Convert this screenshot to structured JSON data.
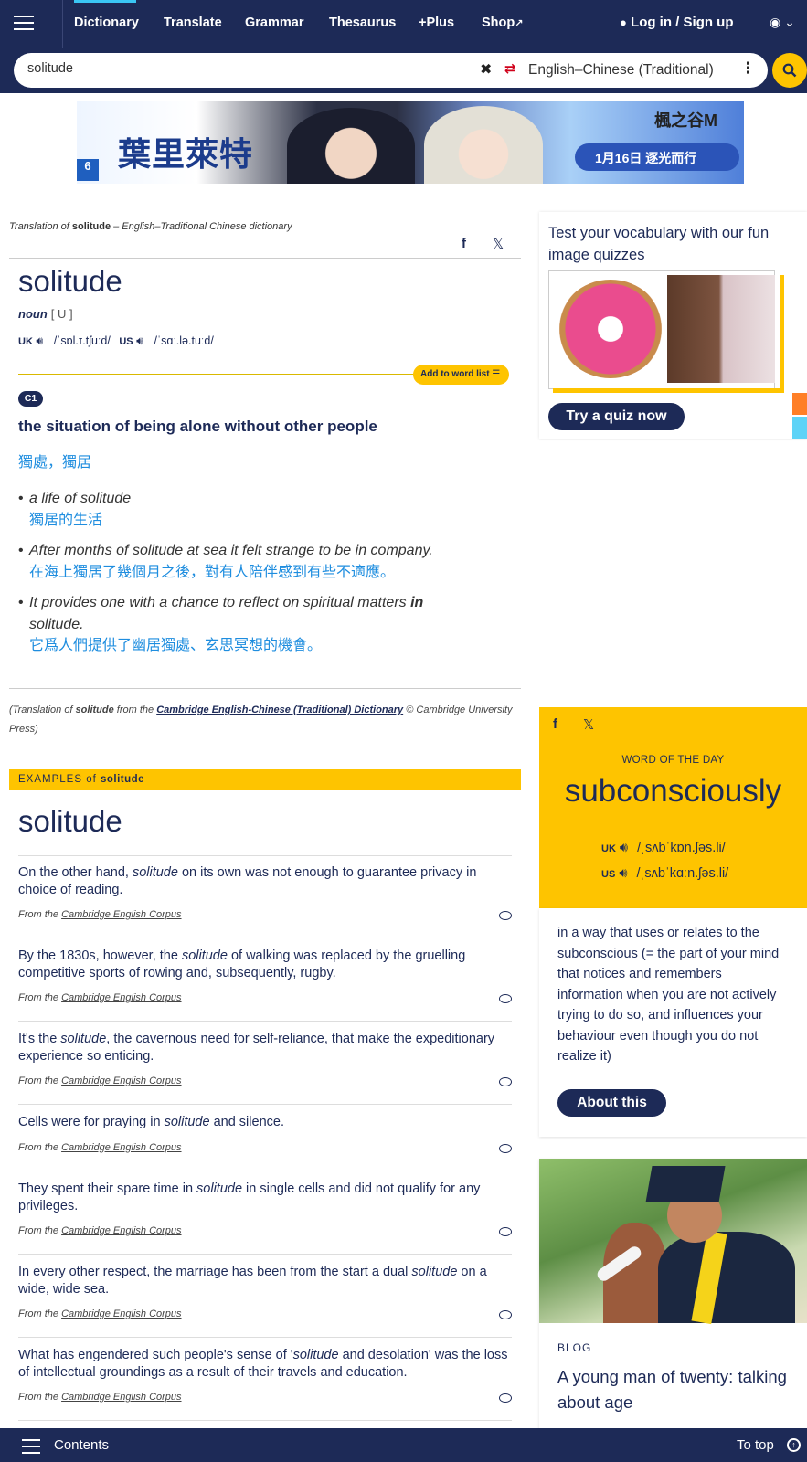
{
  "nav": {
    "items": [
      "Dictionary",
      "Translate",
      "Grammar",
      "Thesaurus",
      "+Plus",
      "Shop"
    ],
    "login": "Log in / Sign up"
  },
  "search": {
    "value": "solitude",
    "language": "English–Chinese (Traditional)"
  },
  "ad": {
    "title": "葉里萊特",
    "date": "1月16日 逐光而行",
    "brand": "楓之谷M",
    "rating": "6"
  },
  "entry": {
    "meta_prefix": "Translation of ",
    "meta_word": "solitude",
    "meta_suffix": " – English–Traditional Chinese dictionary",
    "headword": "solitude",
    "pos": "noun",
    "gram": "[ U ]",
    "uk_label": "UK",
    "uk_ipa": "/ˈsɒl.ɪ.tʃuːd/",
    "us_label": "US",
    "us_ipa": "/ˈsɑː.lə.tuːd/",
    "add_to_list": "Add to word list",
    "level": "C1",
    "definition": "the situation of being alone without other people",
    "translation": "獨處，獨居",
    "examples": [
      {
        "en": "a life of solitude",
        "zh": "獨居的生活"
      },
      {
        "en": "After months of solitude at sea it felt strange to be in company.",
        "zh": "在海上獨居了幾個月之後，對有人陪伴感到有些不適應。"
      },
      {
        "en_before": "It provides one with a chance to reflect on spiritual matters ",
        "en_bold": "in",
        "en_after": " solitude.",
        "zh": "它爲人們提供了幽居獨處、玄思冥想的機會。"
      }
    ],
    "credit_a": "(Translation of ",
    "credit_word": "solitude",
    "credit_b": " from the ",
    "credit_link": "Cambridge English-Chinese (Traditional) Dictionary",
    "credit_c": " © Cambridge University Press)"
  },
  "examples_section": {
    "bar_label": "EXAMPLES of ",
    "bar_word": "solitude",
    "headword": "solitude",
    "from_prefix": "From the ",
    "source": "Cambridge English Corpus",
    "items": [
      {
        "a": "On the other hand, ",
        "w": "solitude",
        "b": " on its own was not enough to guarantee privacy in choice of reading."
      },
      {
        "a": "By the 1830s, however, the ",
        "w": "solitude",
        "b": " of walking was replaced by the gruelling competitive sports of rowing and, subsequently, rugby."
      },
      {
        "a": "It's the ",
        "w": "solitude",
        "b": ", the cavernous need for self-reliance, that make the expeditionary experience so enticing."
      },
      {
        "a": "Cells were for praying in ",
        "w": "solitude",
        "b": " and silence."
      },
      {
        "a": "They spent their spare time in ",
        "w": "solitude",
        "b": " in single cells and did not qualify for any privileges."
      },
      {
        "a": "In every other respect, the marriage has been from the start a dual ",
        "w": "solitude",
        "b": " on a wide, wide sea."
      },
      {
        "a": "What has engendered such people's sense of '",
        "w": "solitude",
        "b": " and desolation' was the loss of intellectual groundings as a result of their travels and education."
      }
    ]
  },
  "quiz": {
    "title": "Test your vocabulary with our fun image quizzes",
    "button": "Try a quiz now"
  },
  "wotd": {
    "label": "WORD OF THE DAY",
    "word": "subconsciously",
    "uk_label": "UK",
    "uk_ipa": "/ˌsʌbˈkɒn.ʃəs.li/",
    "us_label": "US",
    "us_ipa": "/ˌsʌbˈkɑːn.ʃəs.li/",
    "definition": "in a way that uses or relates to the subconscious (= the part of your mind that notices and remembers information when you are not actively trying to do so, and influences your behaviour even though you do not realize it)",
    "button": "About this"
  },
  "blog": {
    "label": "BLOG",
    "title": "A young man of twenty: talking about age"
  },
  "bottom": {
    "contents": "Contents",
    "to_top": "To top"
  },
  "colors": {
    "navy": "#1d2a57",
    "yellow": "#fec400",
    "link_blue": "#1e8ddf"
  }
}
